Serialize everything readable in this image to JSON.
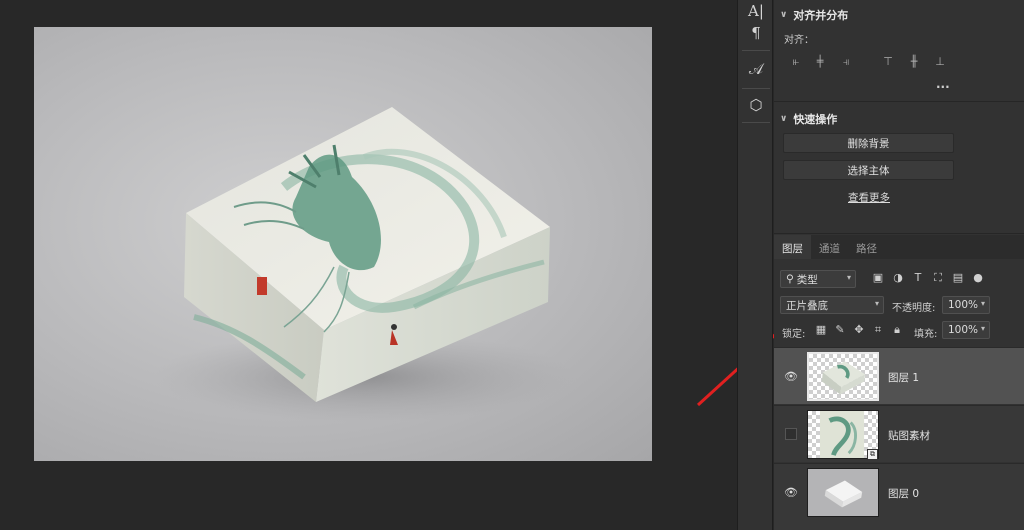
{
  "icon_strip": {
    "items": [
      {
        "name": "character-icon",
        "glyph": "A|"
      },
      {
        "name": "paragraph-icon",
        "glyph": "¶"
      },
      {
        "name": "glyphs-icon",
        "glyph": "𝒜"
      },
      {
        "name": "3d-cube-icon",
        "glyph": "⬡"
      }
    ]
  },
  "align_panel": {
    "title": "对齐并分布",
    "align_label": "对齐：",
    "more_glyph": "···"
  },
  "quick_actions": {
    "title": "快速操作",
    "remove_bg_label": "删除背景",
    "select_subject_label": "选择主体",
    "see_more_label": "查看更多"
  },
  "layers_panel": {
    "tabs": [
      {
        "label": "图层",
        "active": true
      },
      {
        "label": "通道",
        "active": false
      },
      {
        "label": "路径",
        "active": false
      }
    ],
    "filter": {
      "label": "类型"
    },
    "blend_mode": "正片叠底",
    "opacity_label": "不透明度:",
    "opacity_value": "100%",
    "lock_label": "锁定:",
    "fill_label": "填充:",
    "fill_value": "100%",
    "layers": [
      {
        "name": "图层 1",
        "visible": true,
        "selected": true
      },
      {
        "name": "贴图素材",
        "visible": false,
        "selected": false,
        "smart_object": true
      },
      {
        "name": "图层 0",
        "visible": true,
        "selected": false
      }
    ]
  },
  "canvas": {
    "stamp_text": "龍",
    "colors": {
      "background": "#282828",
      "annotation_arrow": "#e02020",
      "dragon": "#5f9a83"
    }
  }
}
